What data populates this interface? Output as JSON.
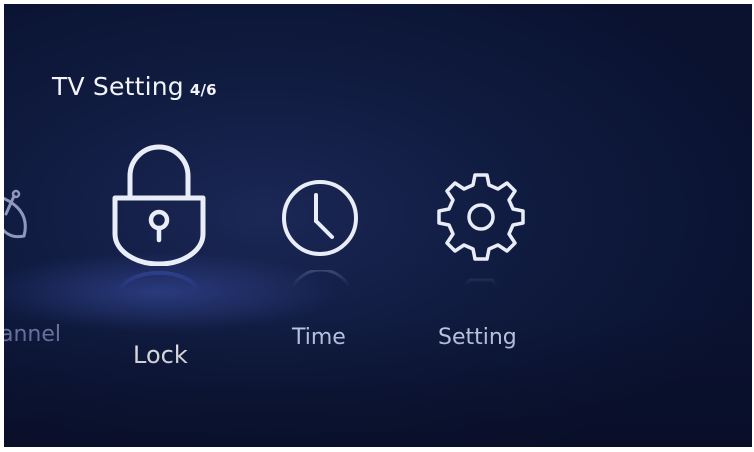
{
  "header": {
    "title": "TV Setting",
    "page_indicator": "4/6"
  },
  "menu": {
    "items": [
      {
        "label": "annel",
        "icon": "satellite-dish-icon",
        "state": "partial"
      },
      {
        "label": "Lock",
        "icon": "lock-icon",
        "state": "selected"
      },
      {
        "label": "Time",
        "icon": "clock-icon",
        "state": "normal"
      },
      {
        "label": "Setting",
        "icon": "gear-icon",
        "state": "normal"
      }
    ]
  },
  "colors": {
    "background": "#101b40",
    "icon_stroke": "#e9edf8",
    "label": "#c9d1ee",
    "accent_glow": "#3c50aa"
  }
}
